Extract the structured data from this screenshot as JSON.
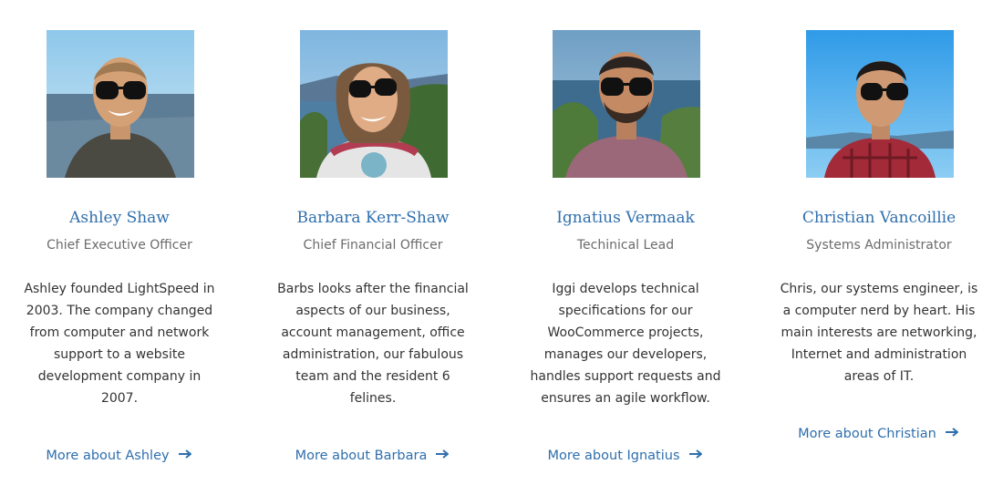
{
  "team": {
    "members": [
      {
        "name": "Ashley Shaw",
        "role": "Chief Executive Officer",
        "bio": "Ashley founded LightSpeed in 2003. The company changed from computer and network support to a website development company in 2007.",
        "link": "More about Ashley"
      },
      {
        "name": "Barbara Kerr-Shaw",
        "role": "Chief Financial Officer",
        "bio": "Barbs looks after the financial aspects of our business, account management, office administration, our fabulous team and the resident 6 felines.",
        "link": "More about Barbara"
      },
      {
        "name": "Ignatius Vermaak",
        "role": "Techinical Lead",
        "bio": "Iggi develops technical specifications for our WooCommerce projects, manages our developers, handles support requests and ensures an agile workflow.",
        "link": "More about Ignatius"
      },
      {
        "name": "Christian Vancoillie",
        "role": "Systems Administrator",
        "bio": "Chris, our systems engineer, is a computer nerd by heart. His main interests are networking, Internet and administration areas of IT.",
        "link": "More about Christian"
      }
    ],
    "link_icon": "arrow-right-icon",
    "colors": {
      "accent": "#2f6fad",
      "role_text": "#6b6b6b",
      "body_text": "#333333"
    }
  }
}
